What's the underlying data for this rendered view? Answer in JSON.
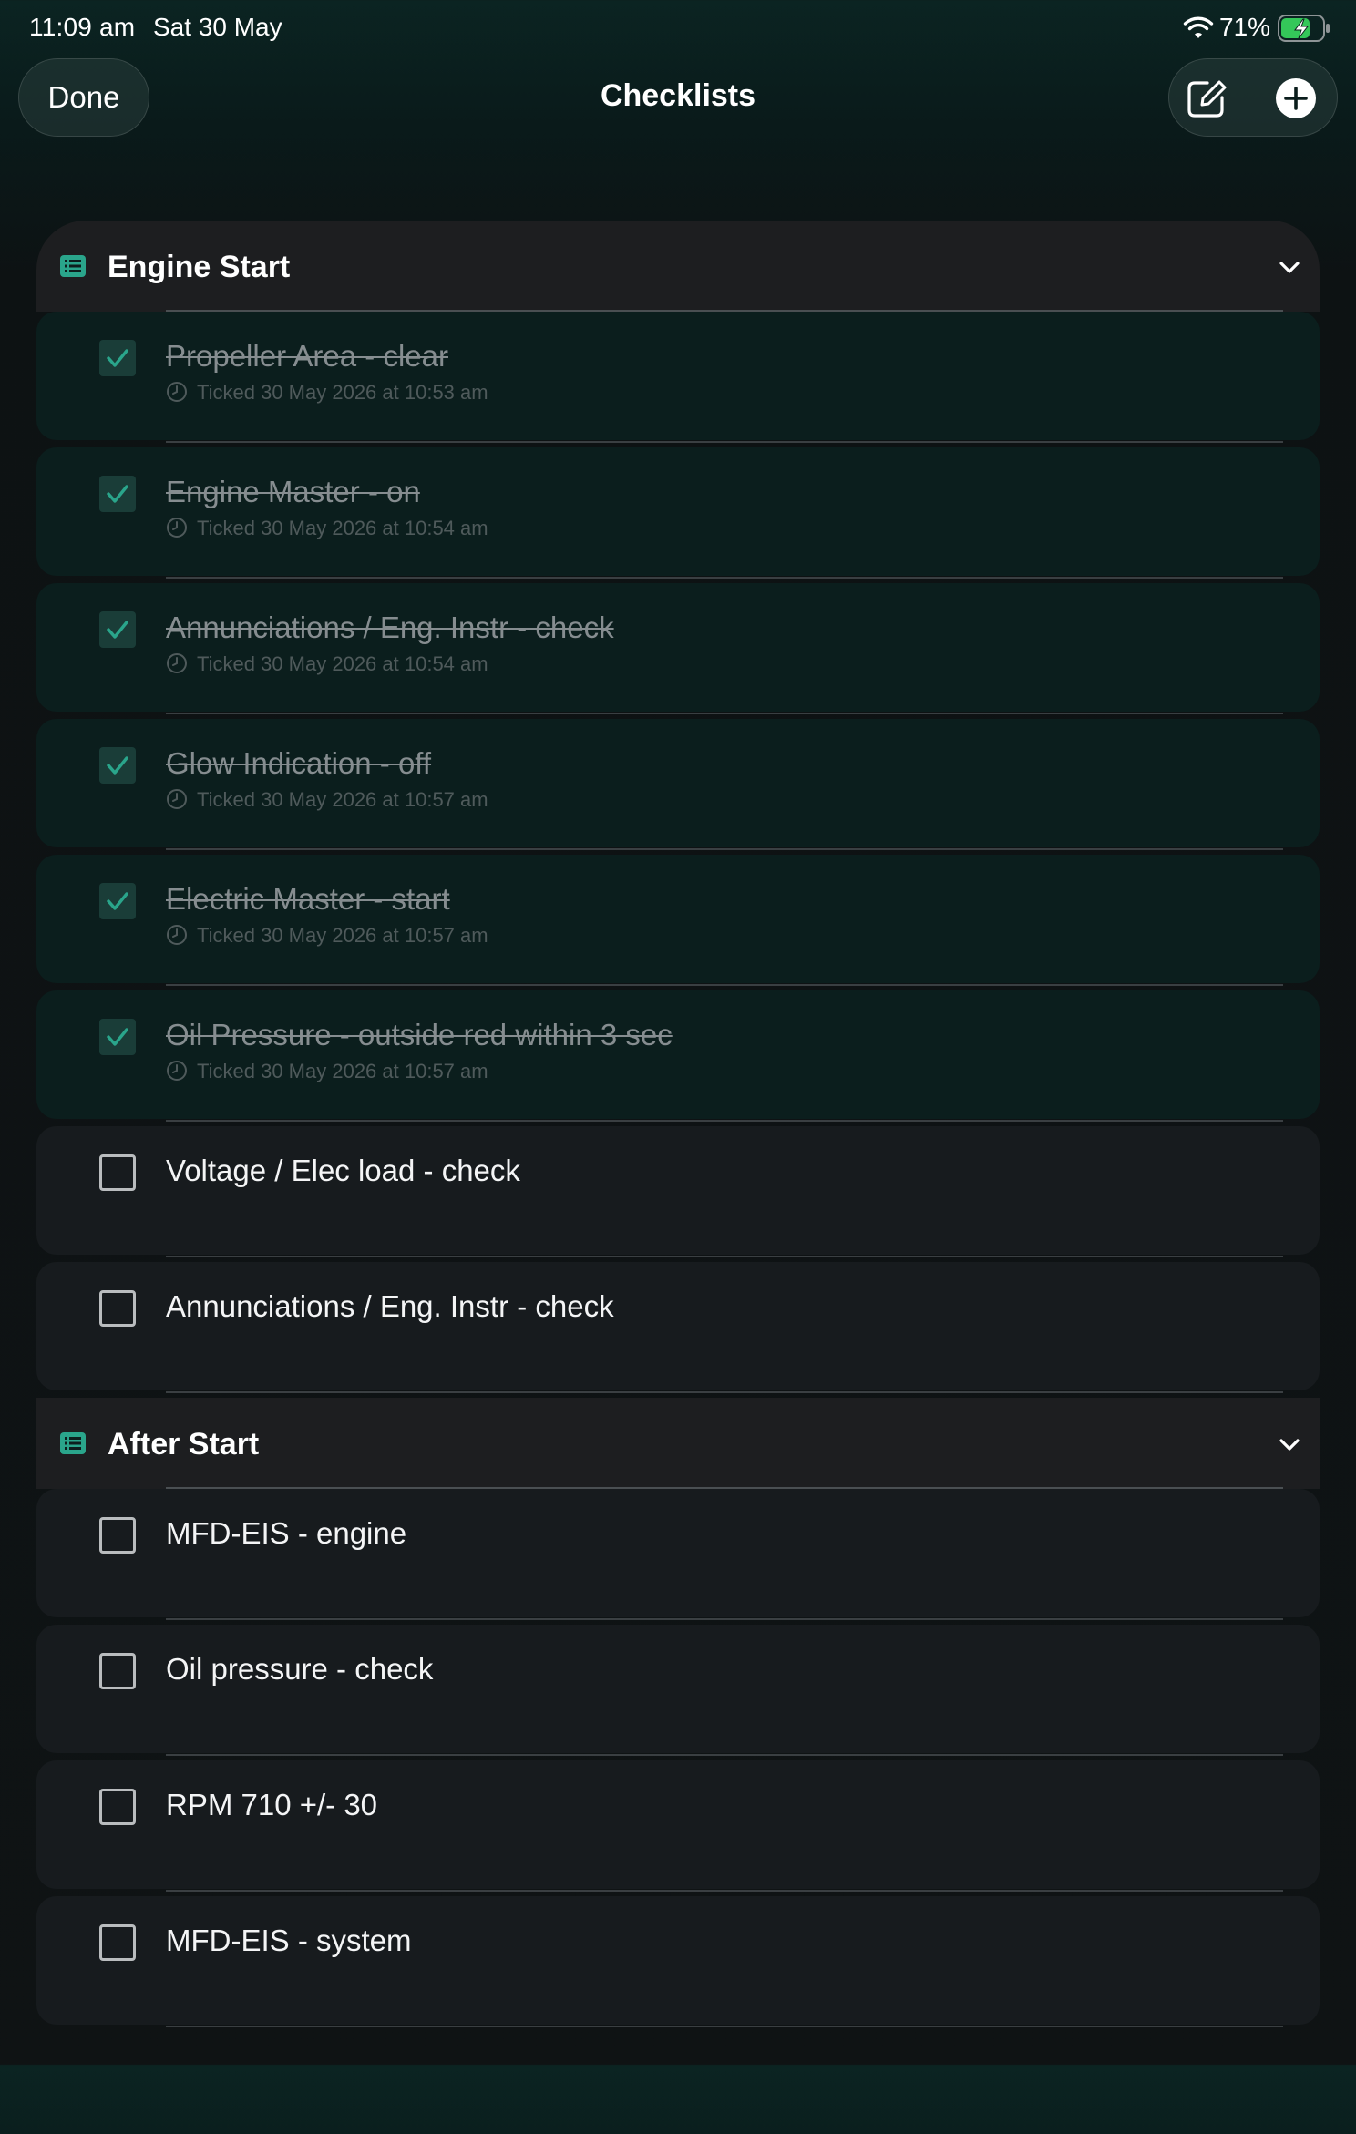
{
  "status_bar": {
    "time": "11:09 am",
    "date": "Sat 30 May",
    "battery_percent": "71%",
    "battery_level": 0.71,
    "charging": true
  },
  "nav": {
    "done_label": "Done",
    "title": "Checklists",
    "edit_icon": "compose-icon",
    "add_icon": "plus-circle-icon"
  },
  "colors": {
    "accent": "#2aa58b",
    "checked_row_bg": "#0b1e1d",
    "unchecked_row_bg": "#171b1e",
    "section_header_bg": "#1d1e20"
  },
  "sections": [
    {
      "title": "Engine Start",
      "icon": "list-icon",
      "expanded": true,
      "items": [
        {
          "label": "Propeller Area - clear",
          "checked": true,
          "ticked": "Ticked 30 May 2026 at 10:53 am"
        },
        {
          "label": "Engine Master - on",
          "checked": true,
          "ticked": "Ticked 30 May 2026 at 10:54 am"
        },
        {
          "label": "Annunciations / Eng. Instr - check",
          "checked": true,
          "ticked": "Ticked 30 May 2026 at 10:54 am"
        },
        {
          "label": "Glow Indication - off",
          "checked": true,
          "ticked": "Ticked 30 May 2026 at 10:57 am"
        },
        {
          "label": "Electric Master - start",
          "checked": true,
          "ticked": "Ticked 30 May 2026 at 10:57 am"
        },
        {
          "label": "Oil Pressure - outside red within 3 sec",
          "checked": true,
          "ticked": "Ticked 30 May 2026 at 10:57 am"
        },
        {
          "label": "Voltage / Elec load - check",
          "checked": false
        },
        {
          "label": "Annunciations / Eng. Instr - check",
          "checked": false
        }
      ]
    },
    {
      "title": "After Start",
      "icon": "list-icon",
      "expanded": true,
      "items": [
        {
          "label": "MFD-EIS - engine",
          "checked": false
        },
        {
          "label": "Oil pressure - check",
          "checked": false
        },
        {
          "label": "RPM 710 +/- 30",
          "checked": false
        },
        {
          "label": "MFD-EIS - system",
          "checked": false
        }
      ]
    }
  ]
}
